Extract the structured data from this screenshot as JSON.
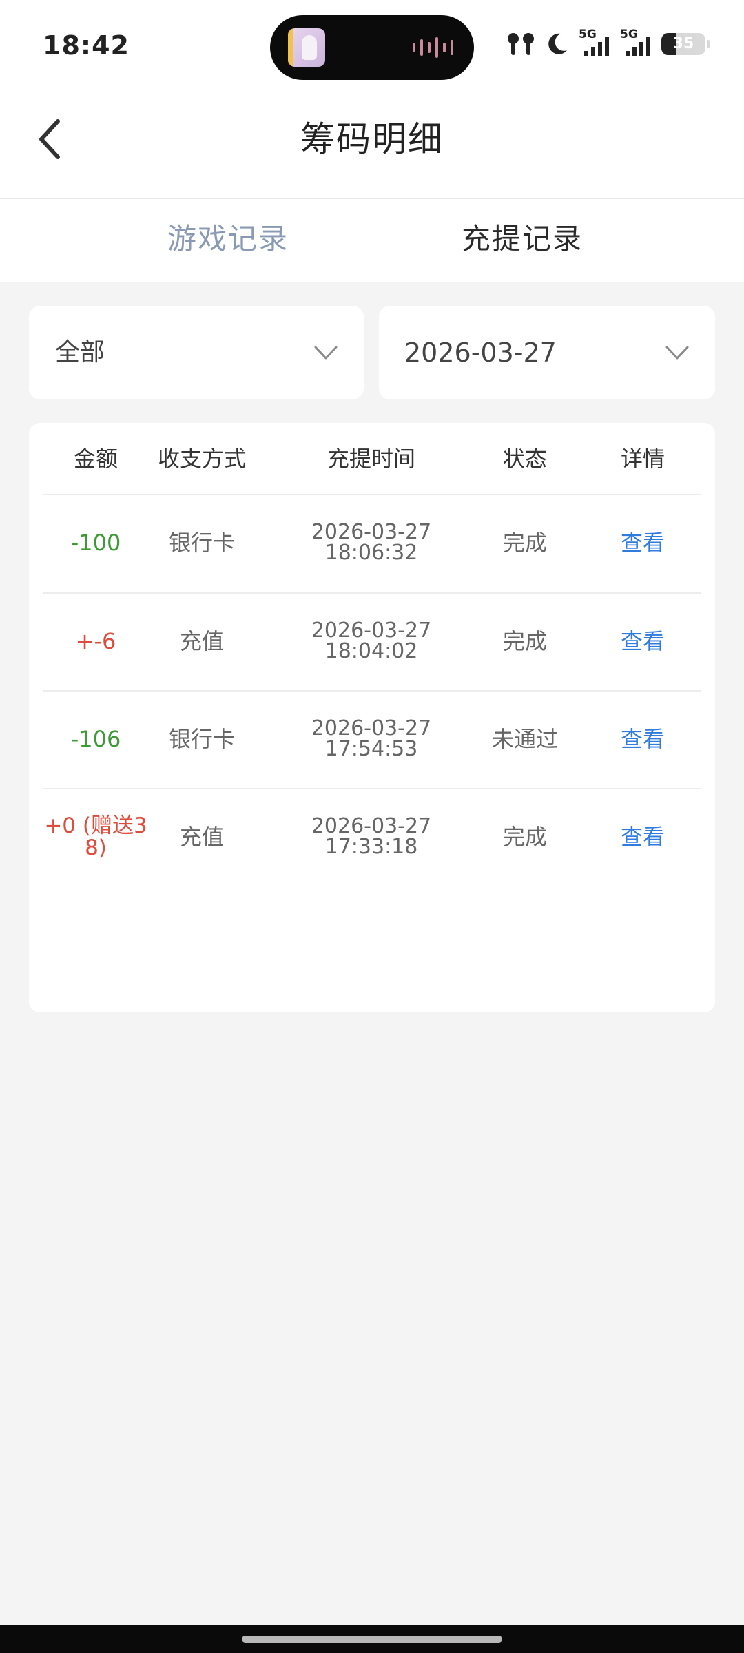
{
  "status_bar": {
    "time": "18:42",
    "island_app_icon": "music-app-icon",
    "network_1": "5G",
    "network_2": "5G",
    "battery_level": "35"
  },
  "header": {
    "title": "筹码明细",
    "back_icon": "chevron-left-icon"
  },
  "tabs": {
    "game_records": "游戏记录",
    "recharge_records": "充提记录",
    "active": "充提记录"
  },
  "filters": {
    "type_value": "全部",
    "date_value": "2026-03-27"
  },
  "table": {
    "headers": {
      "amount": "金额",
      "method": "收支方式",
      "time": "充提时间",
      "status": "状态",
      "detail": "详情"
    },
    "rows": [
      {
        "amount": "-100",
        "method": "银行卡",
        "date": "2026-03-27",
        "time": "18:06:32",
        "status": "完成",
        "detail": "查看"
      },
      {
        "amount": "+-6",
        "method": "充值",
        "date": "2026-03-27",
        "time": "18:04:02",
        "status": "完成",
        "detail": "查看"
      },
      {
        "amount": "-106",
        "method": "银行卡",
        "date": "2026-03-27",
        "time": "17:54:53",
        "status": "未通过",
        "detail": "查看"
      },
      {
        "amount_line1": "+0 (赠送3",
        "amount_line2": "8)",
        "method": "充值",
        "date": "2026-03-27",
        "time": "17:33:18",
        "status": "完成",
        "detail": "查看"
      }
    ]
  },
  "colors": {
    "negative_amount": "#3d9a34",
    "positive_amount": "#de4c3c",
    "link": "#2f7be0",
    "tab_inactive": "#8a9ab5",
    "background": "#f4f4f5"
  }
}
